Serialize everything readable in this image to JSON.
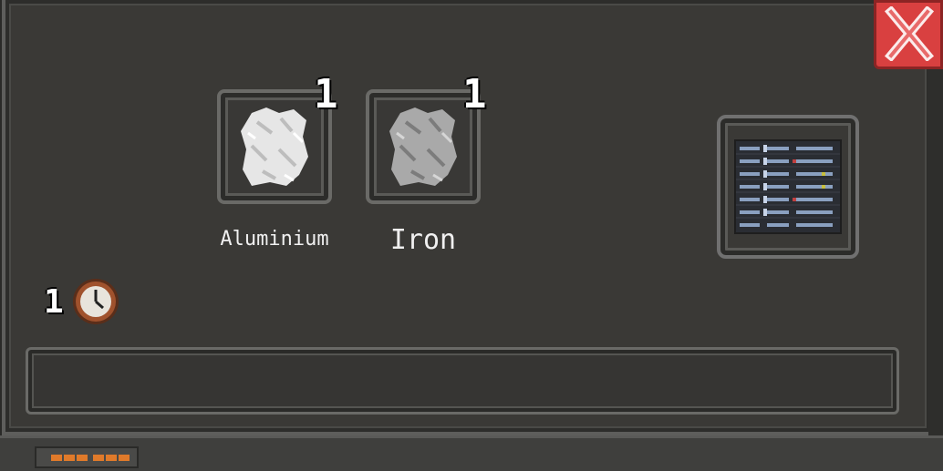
{
  "window": {
    "close_icon": "close-x-icon",
    "close_color": "#d94040"
  },
  "ingredients": [
    {
      "name": "Aluminium",
      "count": "1",
      "icon": "aluminium-ore-icon"
    },
    {
      "name": "Iron",
      "count": "1",
      "icon": "iron-ore-icon"
    }
  ],
  "recipe_book": {
    "icon": "recipe-list-icon"
  },
  "craft_time": {
    "value": "1",
    "icon": "clock-icon"
  },
  "progress": {
    "value": 0
  },
  "footer": {
    "icon": "status-lights-icon"
  }
}
